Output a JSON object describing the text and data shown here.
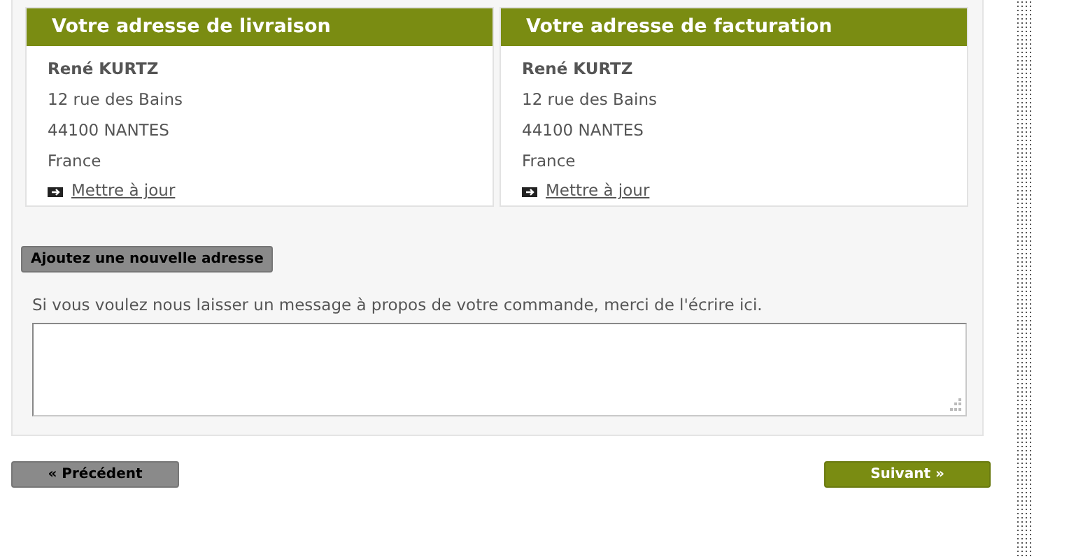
{
  "addresses": [
    {
      "title": "Votre adresse de livraison",
      "name": "René KURTZ",
      "lines": [
        "12 rue des Bains",
        "44100 NANTES",
        "France"
      ],
      "update_link": "Mettre à jour"
    },
    {
      "title": "Votre adresse de facturation",
      "name": "René KURTZ",
      "lines": [
        "12 rue des Bains",
        "44100 NANTES",
        "France"
      ],
      "update_link": "Mettre à jour"
    }
  ],
  "add_address_button": "Ajoutez une nouvelle adresse",
  "message": {
    "label": "Si vous voulez nous laisser un message à propos de votre commande, merci de l'écrire ici."
  },
  "nav": {
    "previous": "« Précédent",
    "next": "Suivant »"
  }
}
